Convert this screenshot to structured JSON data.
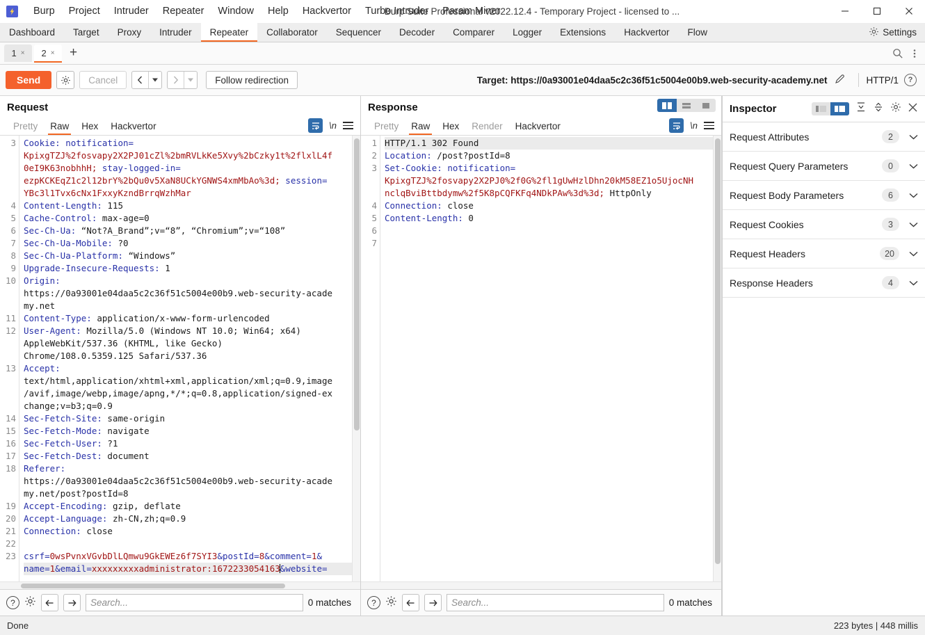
{
  "titlebar": {
    "logo_icon": "burp-logo-icon",
    "window_title": "Burp Suite Professional v2022.12.4 - Temporary Project - licensed to ...",
    "menu": [
      "Burp",
      "Project",
      "Intruder",
      "Repeater",
      "Window",
      "Help",
      "Hackvertor",
      "Turbo Intruder",
      "Param Miner"
    ],
    "minimize": "−",
    "maximize": "☐",
    "close": "✕"
  },
  "main_tabs": {
    "items": [
      "Dashboard",
      "Target",
      "Proxy",
      "Intruder",
      "Repeater",
      "Collaborator",
      "Sequencer",
      "Decoder",
      "Comparer",
      "Logger",
      "Extensions",
      "Hackvertor",
      "Flow"
    ],
    "active": "Repeater",
    "settings_label": "Settings",
    "settings_icon": "gear-icon"
  },
  "repeater_tabs": {
    "items": [
      {
        "label": "1",
        "close": "×",
        "active": false
      },
      {
        "label": "2",
        "close": "×",
        "active": true
      }
    ],
    "add_label": "+",
    "search_icon": "search-icon",
    "more_icon": "kebab-menu-icon"
  },
  "sendbar": {
    "send_label": "Send",
    "gear_icon": "gear-icon",
    "cancel_label": "Cancel",
    "back_arrow": "‹",
    "forward_arrow": "›",
    "caret": "▾",
    "follow_redirection_label": "Follow redirection",
    "target_label": "Target: https://0a93001e04daa5c2c36f51c5004e00b9.web-security-academy.net",
    "pencil_icon": "pencil-edit-icon",
    "http_version": "HTTP/1",
    "help_icon": "help-circle-icon"
  },
  "request": {
    "title": "Request",
    "tabs": [
      {
        "label": "Pretty",
        "state": "muted"
      },
      {
        "label": "Raw",
        "state": "active"
      },
      {
        "label": "Hex",
        "state": "normal"
      },
      {
        "label": "Hackvertor",
        "state": "normal"
      }
    ],
    "wrap_icon": "line-wrap-icon",
    "newline_label": "\\n",
    "menu_icon": "hamburger-menu-icon",
    "lines": [
      {
        "n": "3",
        "segs": [
          {
            "t": "Cookie: ",
            "c": "k"
          },
          {
            "t": "notification=",
            "c": "k"
          }
        ]
      },
      {
        "n": "",
        "segs": [
          {
            "t": "KpixgTZJ%2fosvapy2X2PJ01cZl%2bmRVLkKe5Xvy%2bCzky1t%2flxlL4f",
            "c": "v"
          }
        ]
      },
      {
        "n": "",
        "segs": [
          {
            "t": "0eI9K63nobhhH; ",
            "c": "v"
          },
          {
            "t": "stay-logged-in=",
            "c": "k"
          }
        ]
      },
      {
        "n": "",
        "segs": [
          {
            "t": "ezpKCKEqZ1c2l12brY%2bQu0v5XaN8UCkYGNWS4xmMbAo%3d; ",
            "c": "v"
          },
          {
            "t": "session=",
            "c": "k"
          }
        ]
      },
      {
        "n": "",
        "segs": [
          {
            "t": "YBc3l1Tvx6cNx1FxxyKzndBrrqWzhMar",
            "c": "v"
          }
        ]
      },
      {
        "n": "4",
        "segs": [
          {
            "t": "Content-Length: ",
            "c": "k"
          },
          {
            "t": "115",
            "c": "plain"
          }
        ]
      },
      {
        "n": "5",
        "segs": [
          {
            "t": "Cache-Control: ",
            "c": "k"
          },
          {
            "t": "max-age=0",
            "c": "plain"
          }
        ]
      },
      {
        "n": "6",
        "segs": [
          {
            "t": "Sec-Ch-Ua: ",
            "c": "k"
          },
          {
            "t": "“Not?A_Brand”;v=“8”, “Chromium”;v=“108”",
            "c": "plain"
          }
        ]
      },
      {
        "n": "7",
        "segs": [
          {
            "t": "Sec-Ch-Ua-Mobile: ",
            "c": "k"
          },
          {
            "t": "?0",
            "c": "plain"
          }
        ]
      },
      {
        "n": "8",
        "segs": [
          {
            "t": "Sec-Ch-Ua-Platform: ",
            "c": "k"
          },
          {
            "t": "“Windows”",
            "c": "plain"
          }
        ]
      },
      {
        "n": "9",
        "segs": [
          {
            "t": "Upgrade-Insecure-Requests: ",
            "c": "k"
          },
          {
            "t": "1",
            "c": "plain"
          }
        ]
      },
      {
        "n": "10",
        "segs": [
          {
            "t": "Origin: ",
            "c": "k"
          }
        ]
      },
      {
        "n": "",
        "segs": [
          {
            "t": "https://0a93001e04daa5c2c36f51c5004e00b9.web-security-acade",
            "c": "plain"
          }
        ]
      },
      {
        "n": "",
        "segs": [
          {
            "t": "my.net",
            "c": "plain"
          }
        ]
      },
      {
        "n": "11",
        "segs": [
          {
            "t": "Content-Type: ",
            "c": "k"
          },
          {
            "t": "application/x-www-form-urlencoded",
            "c": "plain"
          }
        ]
      },
      {
        "n": "12",
        "segs": [
          {
            "t": "User-Agent: ",
            "c": "k"
          },
          {
            "t": "Mozilla/5.0 (Windows NT 10.0; Win64; x64)",
            "c": "plain"
          }
        ]
      },
      {
        "n": "",
        "segs": [
          {
            "t": "AppleWebKit/537.36 (KHTML, like Gecko)",
            "c": "plain"
          }
        ]
      },
      {
        "n": "",
        "segs": [
          {
            "t": "Chrome/108.0.5359.125 Safari/537.36",
            "c": "plain"
          }
        ]
      },
      {
        "n": "13",
        "segs": [
          {
            "t": "Accept: ",
            "c": "k"
          }
        ]
      },
      {
        "n": "",
        "segs": [
          {
            "t": "text/html,application/xhtml+xml,application/xml;q=0.9,image",
            "c": "plain"
          }
        ]
      },
      {
        "n": "",
        "segs": [
          {
            "t": "/avif,image/webp,image/apng,*/*;q=0.8,application/signed-ex",
            "c": "plain"
          }
        ]
      },
      {
        "n": "",
        "segs": [
          {
            "t": "change;v=b3;q=0.9",
            "c": "plain"
          }
        ]
      },
      {
        "n": "14",
        "segs": [
          {
            "t": "Sec-Fetch-Site: ",
            "c": "k"
          },
          {
            "t": "same-origin",
            "c": "plain"
          }
        ]
      },
      {
        "n": "15",
        "segs": [
          {
            "t": "Sec-Fetch-Mode: ",
            "c": "k"
          },
          {
            "t": "navigate",
            "c": "plain"
          }
        ]
      },
      {
        "n": "16",
        "segs": [
          {
            "t": "Sec-Fetch-User: ",
            "c": "k"
          },
          {
            "t": "?1",
            "c": "plain"
          }
        ]
      },
      {
        "n": "17",
        "segs": [
          {
            "t": "Sec-Fetch-Dest: ",
            "c": "k"
          },
          {
            "t": "document",
            "c": "plain"
          }
        ]
      },
      {
        "n": "18",
        "segs": [
          {
            "t": "Referer: ",
            "c": "k"
          }
        ]
      },
      {
        "n": "",
        "segs": [
          {
            "t": "https://0a93001e04daa5c2c36f51c5004e00b9.web-security-acade",
            "c": "plain"
          }
        ]
      },
      {
        "n": "",
        "segs": [
          {
            "t": "my.net/post?postId=8",
            "c": "plain"
          }
        ]
      },
      {
        "n": "19",
        "segs": [
          {
            "t": "Accept-Encoding: ",
            "c": "k"
          },
          {
            "t": "gzip, deflate",
            "c": "plain"
          }
        ]
      },
      {
        "n": "20",
        "segs": [
          {
            "t": "Accept-Language: ",
            "c": "k"
          },
          {
            "t": "zh-CN,zh;q=0.9",
            "c": "plain"
          }
        ]
      },
      {
        "n": "21",
        "segs": [
          {
            "t": "Connection: ",
            "c": "k"
          },
          {
            "t": "close",
            "c": "plain"
          }
        ]
      },
      {
        "n": "22",
        "segs": [
          {
            "t": "",
            "c": "plain"
          }
        ]
      },
      {
        "n": "23",
        "segs": [
          {
            "t": "csrf=",
            "c": "k"
          },
          {
            "t": "0wsPvnxVGvbDlLQmwu9GkEWEz6f7SYI3",
            "c": "v"
          },
          {
            "t": "&",
            "c": "k"
          },
          {
            "t": "postId=",
            "c": "k"
          },
          {
            "t": "8",
            "c": "v"
          },
          {
            "t": "&",
            "c": "k"
          },
          {
            "t": "comment=",
            "c": "k"
          },
          {
            "t": "1",
            "c": "v"
          },
          {
            "t": "&",
            "c": "k"
          }
        ]
      },
      {
        "n": "",
        "segs": [
          {
            "t": "name=",
            "c": "k"
          },
          {
            "t": "1",
            "c": "v"
          },
          {
            "t": "&",
            "c": "k"
          },
          {
            "t": "email=",
            "c": "k"
          },
          {
            "t": "xxxxxxxxxadministrator:1672233054163",
            "c": "v"
          },
          {
            "t": "&",
            "c": "k"
          },
          {
            "t": "website=",
            "c": "k"
          }
        ],
        "hl": true,
        "caret_after": 4
      }
    ],
    "search_placeholder": "Search...",
    "matches": "0 matches",
    "help_icon": "help-circle-icon",
    "gear_icon": "gear-icon",
    "prev_icon": "arrow-left-icon",
    "next_icon": "arrow-right-icon"
  },
  "response": {
    "title": "Response",
    "tabs": [
      {
        "label": "Pretty",
        "state": "muted"
      },
      {
        "label": "Raw",
        "state": "active"
      },
      {
        "label": "Hex",
        "state": "normal"
      },
      {
        "label": "Render",
        "state": "muted"
      },
      {
        "label": "Hackvertor",
        "state": "normal"
      }
    ],
    "layout_toggle": [
      {
        "name": "split-vertical-icon",
        "active": true
      },
      {
        "name": "split-horizontal-icon",
        "active": false
      },
      {
        "name": "single-pane-icon",
        "active": false
      }
    ],
    "wrap_icon": "line-wrap-icon",
    "newline_label": "\\n",
    "menu_icon": "hamburger-menu-icon",
    "lines": [
      {
        "n": "1",
        "segs": [
          {
            "t": "HTTP/1.1 302 Found",
            "c": "plain"
          }
        ],
        "hl": true
      },
      {
        "n": "2",
        "segs": [
          {
            "t": "Location: ",
            "c": "k"
          },
          {
            "t": "/post?postId=8",
            "c": "plain"
          }
        ]
      },
      {
        "n": "3",
        "segs": [
          {
            "t": "Set-Cookie: ",
            "c": "k"
          },
          {
            "t": "notification=",
            "c": "k"
          }
        ]
      },
      {
        "n": "",
        "segs": [
          {
            "t": "KpixgTZJ%2fosvapy2X2PJ0%2f0G%2fl1gUwHzlDhn20kM58EZ1o5UjocNH",
            "c": "v"
          }
        ]
      },
      {
        "n": "",
        "segs": [
          {
            "t": "nclqBviBttbdymw%2f5K8pCQFKFq4NDkPAw%3d%3d; ",
            "c": "v"
          },
          {
            "t": "HttpOnly",
            "c": "plain"
          }
        ]
      },
      {
        "n": "4",
        "segs": [
          {
            "t": "Connection: ",
            "c": "k"
          },
          {
            "t": "close",
            "c": "plain"
          }
        ]
      },
      {
        "n": "5",
        "segs": [
          {
            "t": "Content-Length: ",
            "c": "k"
          },
          {
            "t": "0",
            "c": "plain"
          }
        ]
      },
      {
        "n": "6",
        "segs": [
          {
            "t": "",
            "c": "plain"
          }
        ]
      },
      {
        "n": "7",
        "segs": [
          {
            "t": "",
            "c": "plain"
          }
        ]
      }
    ],
    "search_placeholder": "Search...",
    "matches": "0 matches",
    "help_icon": "help-circle-icon",
    "gear_icon": "gear-icon",
    "prev_icon": "arrow-left-icon",
    "next_icon": "arrow-right-icon"
  },
  "inspector": {
    "title": "Inspector",
    "view_toggle": [
      {
        "name": "inspector-left-layout-icon",
        "active": false
      },
      {
        "name": "inspector-right-layout-icon",
        "active": true
      }
    ],
    "expand_all_icon": "expand-all-icon",
    "collapse_all_icon": "collapse-all-icon",
    "gear_icon": "gear-icon",
    "close_icon": "close-icon",
    "sections": [
      {
        "label": "Request Attributes",
        "count": "2"
      },
      {
        "label": "Request Query Parameters",
        "count": "0"
      },
      {
        "label": "Request Body Parameters",
        "count": "6"
      },
      {
        "label": "Request Cookies",
        "count": "3"
      },
      {
        "label": "Request Headers",
        "count": "20"
      },
      {
        "label": "Response Headers",
        "count": "4"
      }
    ]
  },
  "statusbar": {
    "status": "Done",
    "metrics": "223 bytes | 448 millis"
  },
  "colors": {
    "accent_orange": "#f4612c",
    "accent_blue": "#2f6cab",
    "key_blue": "#2831a8",
    "value_red": "#a11515",
    "logo_purple": "#4d5ed4"
  }
}
